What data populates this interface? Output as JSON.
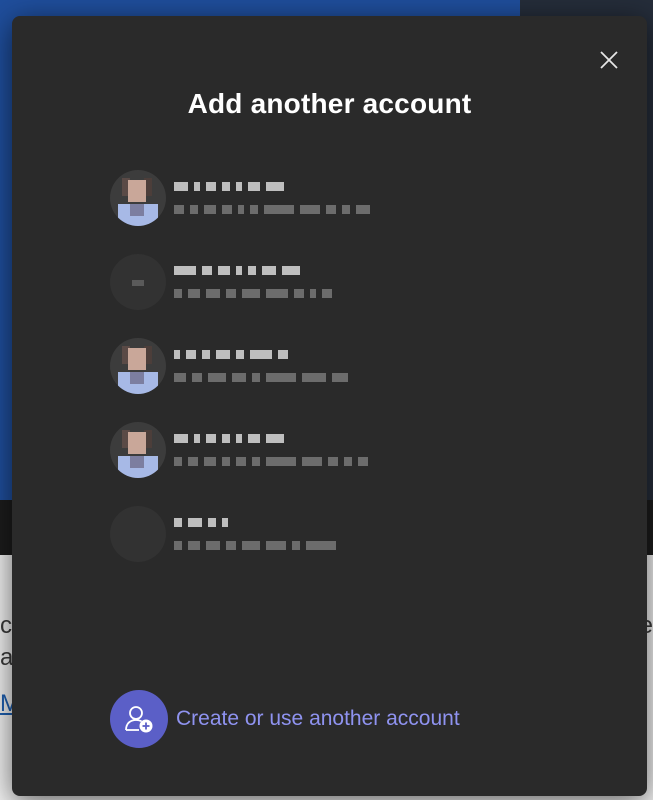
{
  "background": {
    "fragments": {
      "left1": "c",
      "left2": "a",
      "left3": "M",
      "right1": "e"
    }
  },
  "dialog": {
    "title": "Add another account",
    "close_icon": "close-icon",
    "accounts": [
      {
        "avatar": "photo",
        "redacted": true
      },
      {
        "avatar": "blank",
        "redacted": true
      },
      {
        "avatar": "photo",
        "redacted": true
      },
      {
        "avatar": "photo",
        "redacted": true
      },
      {
        "avatar": "blank",
        "redacted": true
      }
    ],
    "create_account": {
      "label": "Create or use another account",
      "icon": "add-person-icon"
    }
  },
  "colors": {
    "dialog_bg": "#2a2a2a",
    "accent": "#5b5fc7",
    "link_text": "#8f93f0",
    "title_text": "#ffffff"
  }
}
